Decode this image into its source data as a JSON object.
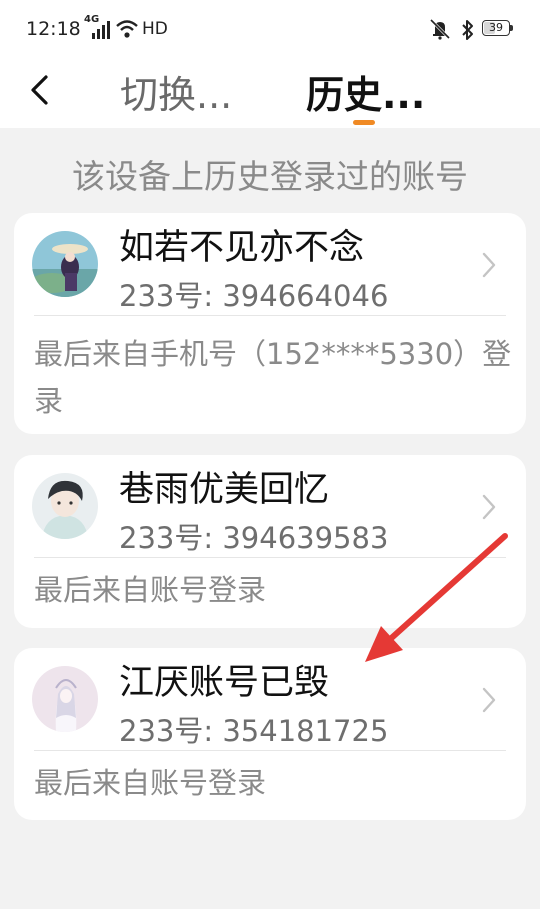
{
  "status_bar": {
    "time": "12:18",
    "network": "4G",
    "hd": "HD",
    "battery": "39"
  },
  "header": {
    "tabs": [
      {
        "label": "切换..."
      },
      {
        "label": "历史..."
      }
    ],
    "accent_color": "#f08a24"
  },
  "section_title": "该设备上历史登录过的账号",
  "accounts": [
    {
      "name": "如若不见亦不念",
      "id_text": "233号: 394664046",
      "last_login": "最后来自手机号（152****5330）登录"
    },
    {
      "name": "巷雨优美回忆",
      "id_text": "233号: 394639583",
      "last_login": "最后来自账号登录"
    },
    {
      "name": "江厌账号已毁",
      "id_text": "233号: 354181725",
      "last_login": "最后来自账号登录"
    }
  ],
  "annotation_color": "#e53935"
}
